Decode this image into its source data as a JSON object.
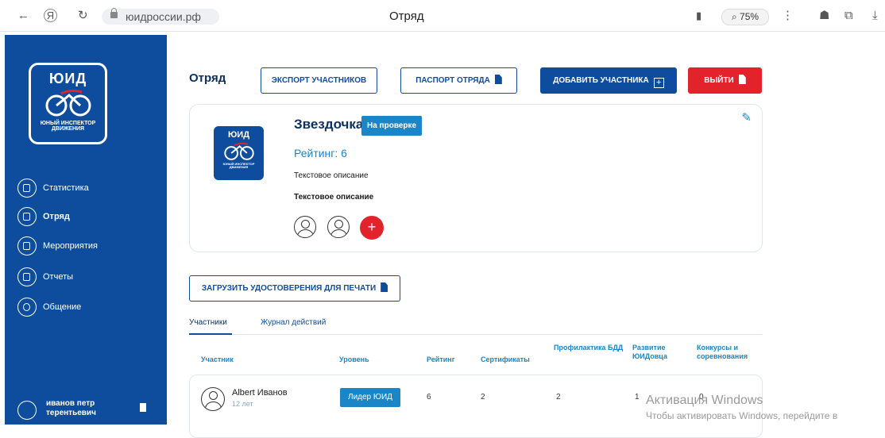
{
  "browser": {
    "domain": "юидроссии.рф",
    "title": "Отряд",
    "zoom": "75%"
  },
  "sidebar": {
    "logo_text": "ЮИД",
    "logo_sub": "ЮНЫЙ ИНСПЕКТОР ДВИЖЕНИЯ",
    "items": [
      {
        "label": "Статистика"
      },
      {
        "label": "Отряд"
      },
      {
        "label": "Мероприятия"
      },
      {
        "label": "Отчеты"
      },
      {
        "label": "Общение"
      }
    ],
    "user_name": "иванов петр",
    "user_name2": "терентьевич"
  },
  "header": {
    "title": "Отряд",
    "export_label": "ЭКСПОРТ УЧАСТНИКОВ",
    "passport_label": "ПАСПОРТ ОТРЯДА",
    "add_label": "ДОБАВИТЬ УЧАСТНИКА",
    "logout_label": "ВЫЙТИ"
  },
  "squad": {
    "logo_text": "ЮИД",
    "logo_sub": "ЮНЫЙ ИНСПЕКТОР ДВИЖЕНИЯ",
    "name": "Звездочка",
    "status": "На проверке",
    "rating": "Рейтинг: 6",
    "description": "Текстовое описание",
    "description_bold": "Текстовое описание"
  },
  "upload_label": "ЗАГРУЗИТЬ УДОСТОВЕРЕНИЯ ДЛЯ ПЕЧАТИ",
  "tabs": [
    {
      "label": "Участники"
    },
    {
      "label": "Журнал действий"
    }
  ],
  "table": {
    "headers": [
      "Участник",
      "Уровень",
      "Рейтинг",
      "Сертификаты",
      "Профилактика БДД",
      "Развитие ЮИДовца",
      "Конкурсы и соревнования"
    ],
    "rows": [
      {
        "name": "Albert Иванов",
        "age": "12 лет",
        "level": "Лидер ЮИД",
        "rating": "6",
        "certificates": "2",
        "prevention": "2",
        "development": "1",
        "contests": "0"
      }
    ]
  },
  "watermark": {
    "line1": "Активация Windows",
    "line2": "Чтобы активировать Windows, перейдите в"
  }
}
